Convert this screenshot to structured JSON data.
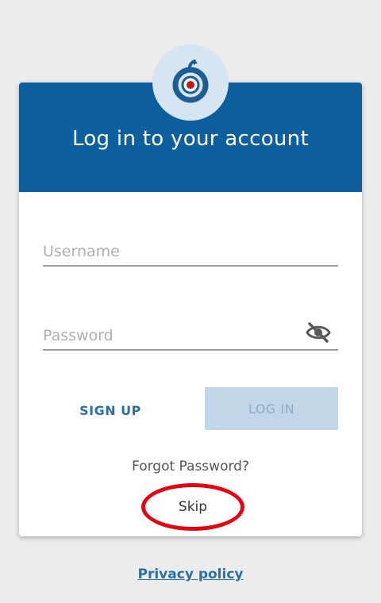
{
  "header": {
    "title": "Log in to your account"
  },
  "form": {
    "username_placeholder": "Username",
    "password_placeholder": "Password"
  },
  "actions": {
    "signup_label": "SIGN UP",
    "login_label": "LOG IN",
    "forgot_label": "Forgot Password?",
    "skip_label": "Skip"
  },
  "footer": {
    "privacy_label": "Privacy policy"
  },
  "icons": {
    "logo": "app-logo-icon",
    "visibility_toggle": "eye-off-icon"
  },
  "colors": {
    "header": "#0e5f9e",
    "accent": "#2a6fa8",
    "login_disabled_bg": "#c1d7e8",
    "annotation": "#e30612"
  }
}
